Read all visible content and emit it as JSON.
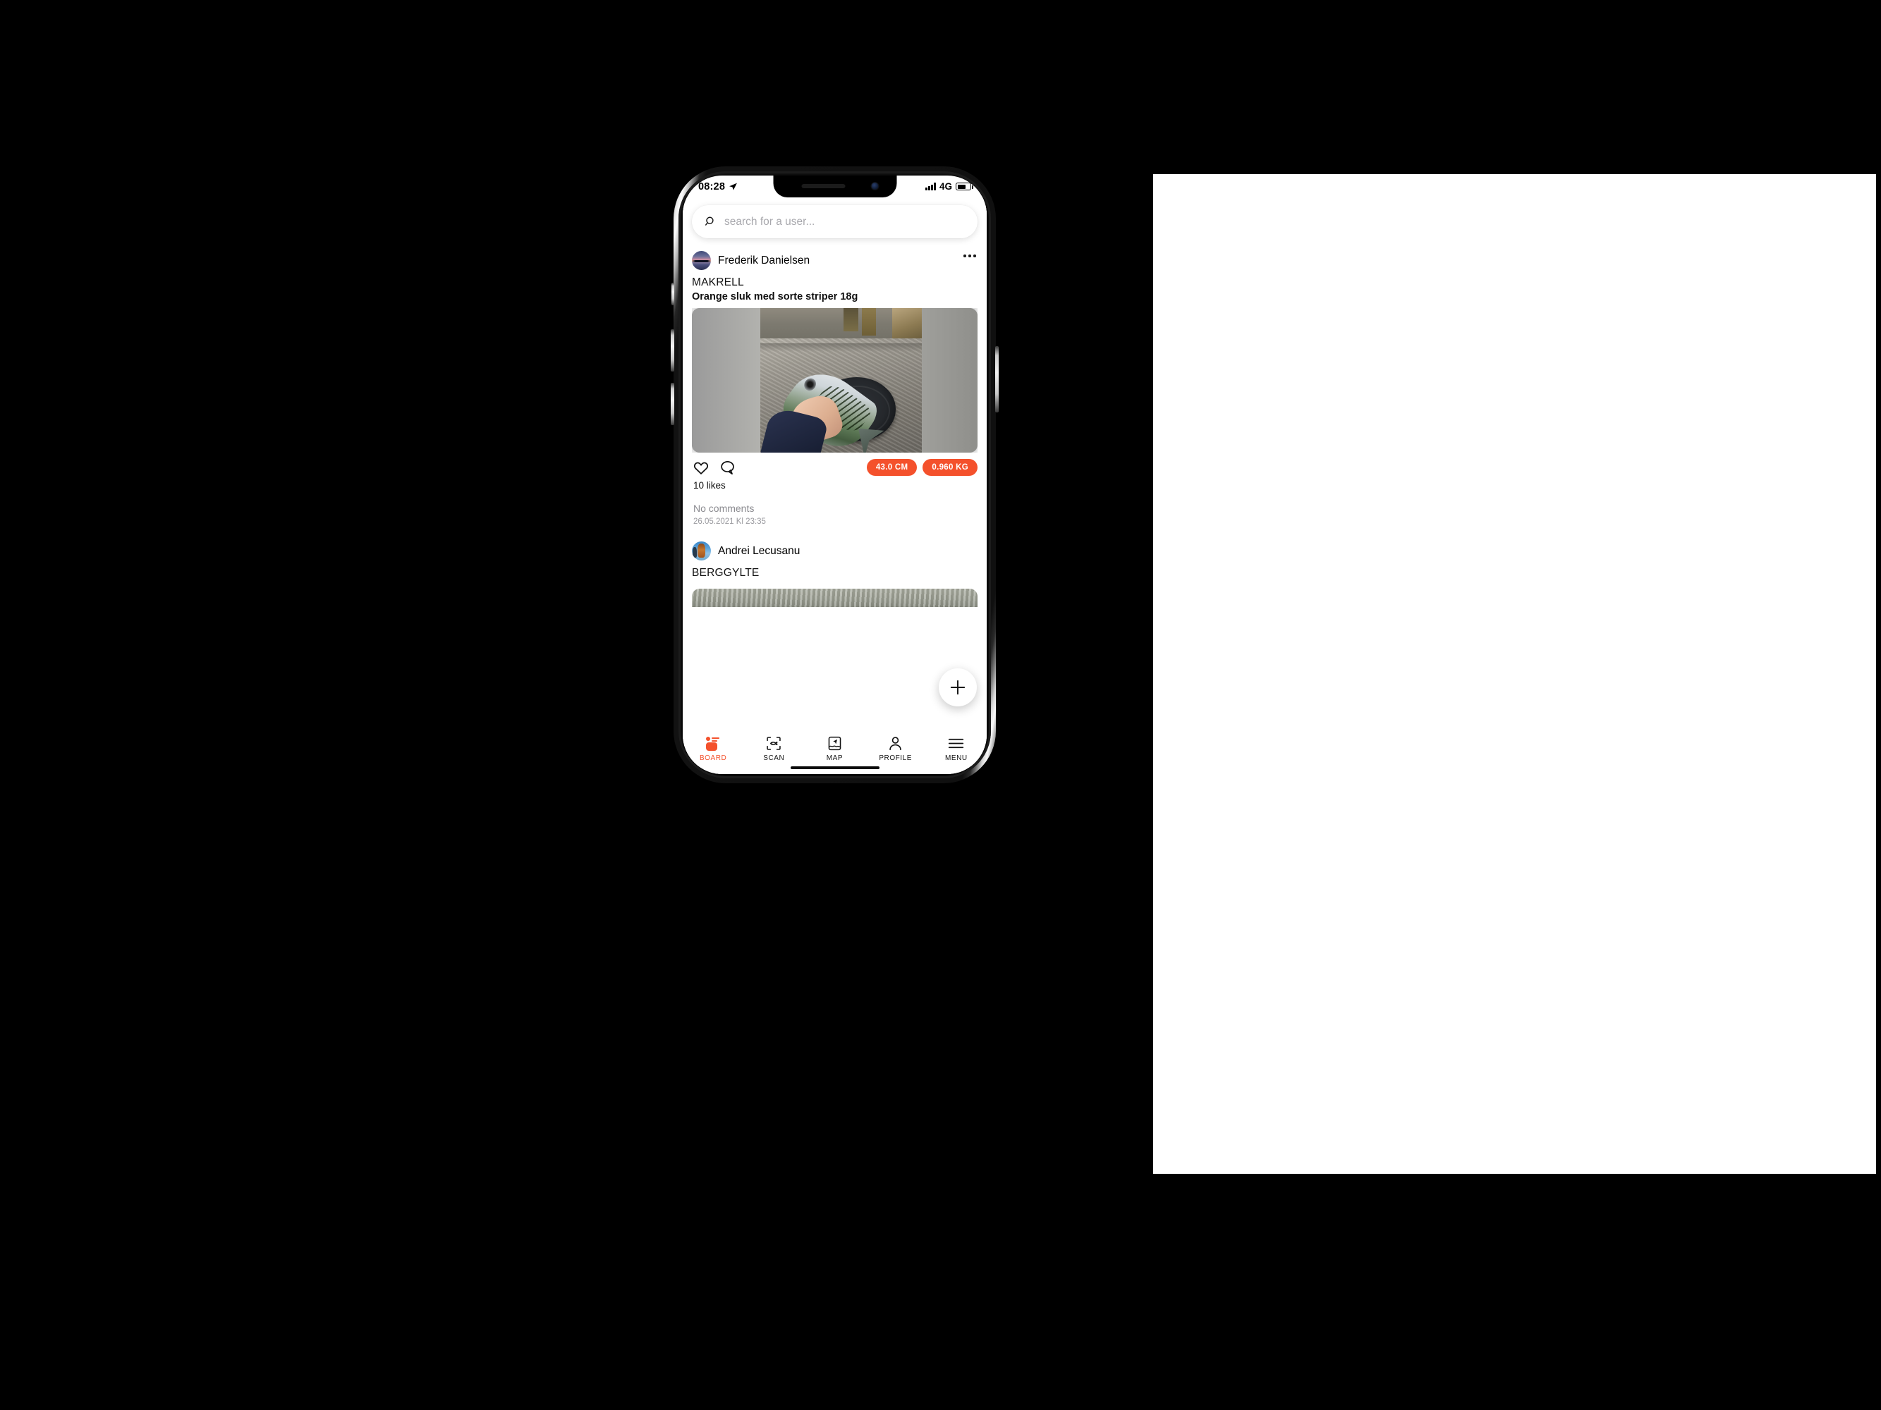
{
  "status_bar": {
    "time": "08:28",
    "location_icon": "location-arrow-icon",
    "signal_icon": "cellular-bars-icon",
    "network": "4G",
    "battery_icon": "battery-icon"
  },
  "search": {
    "icon": "search-icon",
    "placeholder": "search for a user...",
    "value": ""
  },
  "feed": {
    "posts": [
      {
        "author": "Frederik Danielsen",
        "avatar": "sunset-lake-avatar",
        "more_icon": "more-options-icon",
        "species": "MAKRELL",
        "lure": "Orange sluk med sorte striper 18g",
        "photo_alt": "mackerel-on-rock-photo",
        "like_icon": "heart-icon",
        "comment_icon": "comment-bubble-icon",
        "badges": [
          "43.0 CM",
          "0.960 KG"
        ],
        "likes": "10 likes",
        "comments": "No comments",
        "timestamp": "26.05.2021 Kl 23:35"
      },
      {
        "author": "Andrei Lecusanu",
        "avatar": "angler-with-fish-avatar",
        "species": "BERGGYLTE",
        "photo_alt": "catch-photo-partial"
      }
    ]
  },
  "fab": {
    "icon": "plus-icon",
    "label": "+"
  },
  "tabbar": {
    "items": [
      {
        "label": "BOARD",
        "icon": "board-icon",
        "active": true
      },
      {
        "label": "SCAN",
        "icon": "scan-fish-icon",
        "active": false
      },
      {
        "label": "MAP",
        "icon": "map-icon",
        "active": false
      },
      {
        "label": "PROFILE",
        "icon": "profile-icon",
        "active": false
      },
      {
        "label": "MENU",
        "icon": "menu-icon",
        "active": false
      }
    ]
  },
  "colors": {
    "accent": "#F4512C",
    "background": "#000000",
    "panel": "#ffffff"
  }
}
